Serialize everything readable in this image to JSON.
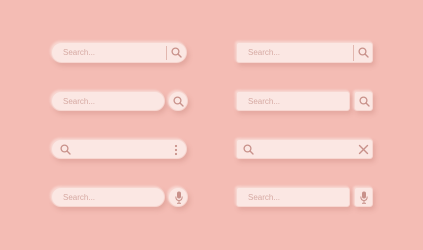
{
  "background_color": "#f4bcb4",
  "bar_color": "#fbe7e3",
  "icon_color": "#c8918a",
  "search_bars": [
    {
      "id": 1,
      "placeholder": "Search...",
      "icons": [
        "search-icon"
      ]
    },
    {
      "id": 2,
      "placeholder": "Search...",
      "icons": [
        "search-icon"
      ]
    },
    {
      "id": 3,
      "placeholder": "Search...",
      "icons": [
        "search-icon"
      ]
    },
    {
      "id": 4,
      "placeholder": "Search...",
      "icons": [
        "search-icon"
      ]
    },
    {
      "id": 5,
      "placeholder": "",
      "icons": [
        "search-icon",
        "more-vertical-icon"
      ]
    },
    {
      "id": 6,
      "placeholder": "",
      "icons": [
        "search-icon",
        "close-icon"
      ]
    },
    {
      "id": 7,
      "placeholder": "Search...",
      "icons": [
        "microphone-icon"
      ]
    },
    {
      "id": 8,
      "placeholder": "Search...",
      "icons": [
        "microphone-icon"
      ]
    }
  ]
}
